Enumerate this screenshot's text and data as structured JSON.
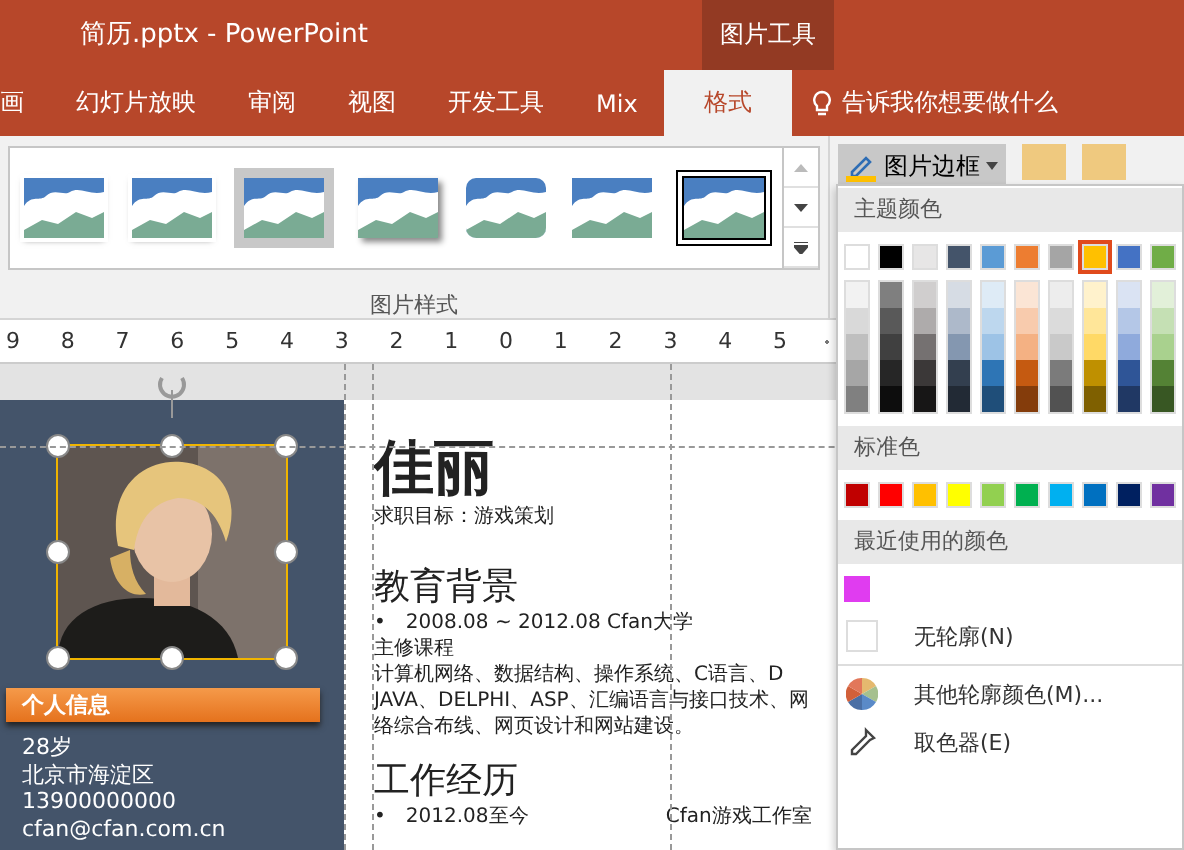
{
  "window": {
    "title": "简历.pptx  -  PowerPoint",
    "context_group": "图片工具"
  },
  "tabs": [
    {
      "label": "画",
      "selected": false
    },
    {
      "label": "幻灯片放映",
      "selected": false
    },
    {
      "label": "审阅",
      "selected": false
    },
    {
      "label": "视图",
      "selected": false
    },
    {
      "label": "开发工具",
      "selected": false
    },
    {
      "label": "Mix",
      "selected": false
    },
    {
      "label": "格式",
      "selected": true
    }
  ],
  "tell_me": "告诉我你想要做什么",
  "ribbon": {
    "styles": [
      {
        "selected": false
      },
      {
        "selected": false
      },
      {
        "selected": false
      },
      {
        "selected": false
      },
      {
        "selected": false
      },
      {
        "selected": false
      },
      {
        "selected": true
      }
    ],
    "group_label": "图片样式",
    "border_button": "图片边框"
  },
  "ruler": [
    "9",
    "8",
    "7",
    "6",
    "5",
    "4",
    "3",
    "2",
    "1",
    "0",
    "1",
    "2",
    "3",
    "4",
    "5"
  ],
  "slide": {
    "info_banner": "个人信息",
    "info": [
      "28岁",
      "北京市海淀区",
      "13900000000",
      "cfan@cfan.com.cn"
    ],
    "name": "佳丽",
    "objective": "求职目标：游戏策划",
    "education": {
      "heading": "教育背景",
      "bullet": {
        "mark": "•",
        "text": "2008.08 ~ 2012.08 Cfan大学"
      },
      "subheading": "主修课程",
      "lines": [
        "计算机网络、数据结构、操作系统、C语言、D",
        "JAVA、DELPHI、ASP、汇编语言与接口技术、网",
        "络综合布线、网页设计和网站建设。"
      ]
    },
    "work": {
      "heading": "工作经历",
      "bullet": {
        "mark": "•",
        "text": "2012.08至今"
      },
      "company": "Cfan游戏工作室"
    }
  },
  "menu": {
    "theme_title": "主题颜色",
    "theme_colors": [
      {
        "color": "#ffffff",
        "selected": false
      },
      {
        "color": "#000000",
        "selected": false
      },
      {
        "color": "#e7e6e6",
        "selected": false
      },
      {
        "color": "#44546a",
        "selected": false
      },
      {
        "color": "#5b9bd5",
        "selected": false
      },
      {
        "color": "#ed7d31",
        "selected": false
      },
      {
        "color": "#a5a5a5",
        "selected": false
      },
      {
        "color": "#ffc000",
        "selected": true
      },
      {
        "color": "#4472c4",
        "selected": false
      },
      {
        "color": "#70ad47",
        "selected": false
      }
    ],
    "shades": [
      [
        {
          "color": "#f2f2f2"
        },
        {
          "color": "#d9d9d9"
        },
        {
          "color": "#bfbfbf"
        },
        {
          "color": "#a6a6a6"
        },
        {
          "color": "#808080"
        }
      ],
      [
        {
          "color": "#7f7f7f"
        },
        {
          "color": "#595959"
        },
        {
          "color": "#404040"
        },
        {
          "color": "#262626"
        },
        {
          "color": "#0d0d0d"
        }
      ],
      [
        {
          "color": "#d0cece"
        },
        {
          "color": "#aeabab"
        },
        {
          "color": "#757171"
        },
        {
          "color": "#3b3838"
        },
        {
          "color": "#171616"
        }
      ],
      [
        {
          "color": "#d6dce4"
        },
        {
          "color": "#adb9ca"
        },
        {
          "color": "#8497b0"
        },
        {
          "color": "#333f4f"
        },
        {
          "color": "#222a35"
        }
      ],
      [
        {
          "color": "#deebf6"
        },
        {
          "color": "#bdd7ee"
        },
        {
          "color": "#9dc3e6"
        },
        {
          "color": "#2e75b5"
        },
        {
          "color": "#1f4e79"
        }
      ],
      [
        {
          "color": "#fbe5d5"
        },
        {
          "color": "#f8cbad"
        },
        {
          "color": "#f4b183"
        },
        {
          "color": "#c55a11"
        },
        {
          "color": "#843c0b"
        }
      ],
      [
        {
          "color": "#ededed"
        },
        {
          "color": "#dbdbdb"
        },
        {
          "color": "#c9c9c9"
        },
        {
          "color": "#7b7b7b"
        },
        {
          "color": "#525252"
        }
      ],
      [
        {
          "color": "#fff2cc"
        },
        {
          "color": "#ffe699"
        },
        {
          "color": "#ffd966"
        },
        {
          "color": "#bf9000"
        },
        {
          "color": "#7f6000"
        }
      ],
      [
        {
          "color": "#dae3f3"
        },
        {
          "color": "#b4c7e7"
        },
        {
          "color": "#8faadc"
        },
        {
          "color": "#2f5597"
        },
        {
          "color": "#203864"
        }
      ],
      [
        {
          "color": "#e2f0d9"
        },
        {
          "color": "#c5e0b4"
        },
        {
          "color": "#a9d18e"
        },
        {
          "color": "#548235"
        },
        {
          "color": "#385723"
        }
      ]
    ],
    "standard_title": "标准色",
    "standard_colors": [
      {
        "color": "#c00000"
      },
      {
        "color": "#ff0000"
      },
      {
        "color": "#ffc000"
      },
      {
        "color": "#ffff00"
      },
      {
        "color": "#92d050"
      },
      {
        "color": "#00b050"
      },
      {
        "color": "#00b0f0"
      },
      {
        "color": "#0070c0"
      },
      {
        "color": "#002060"
      },
      {
        "color": "#7030a0"
      }
    ],
    "recent_title": "最近使用的颜色",
    "recent_colors": [
      {
        "color": "#e03cf0"
      }
    ],
    "items": [
      {
        "kind": "none",
        "label": "无轮廓(N)"
      },
      {
        "kind": "more",
        "label": "其他轮廓颜色(M)..."
      },
      {
        "kind": "eyedropper",
        "label": "取色器(E)"
      }
    ]
  }
}
